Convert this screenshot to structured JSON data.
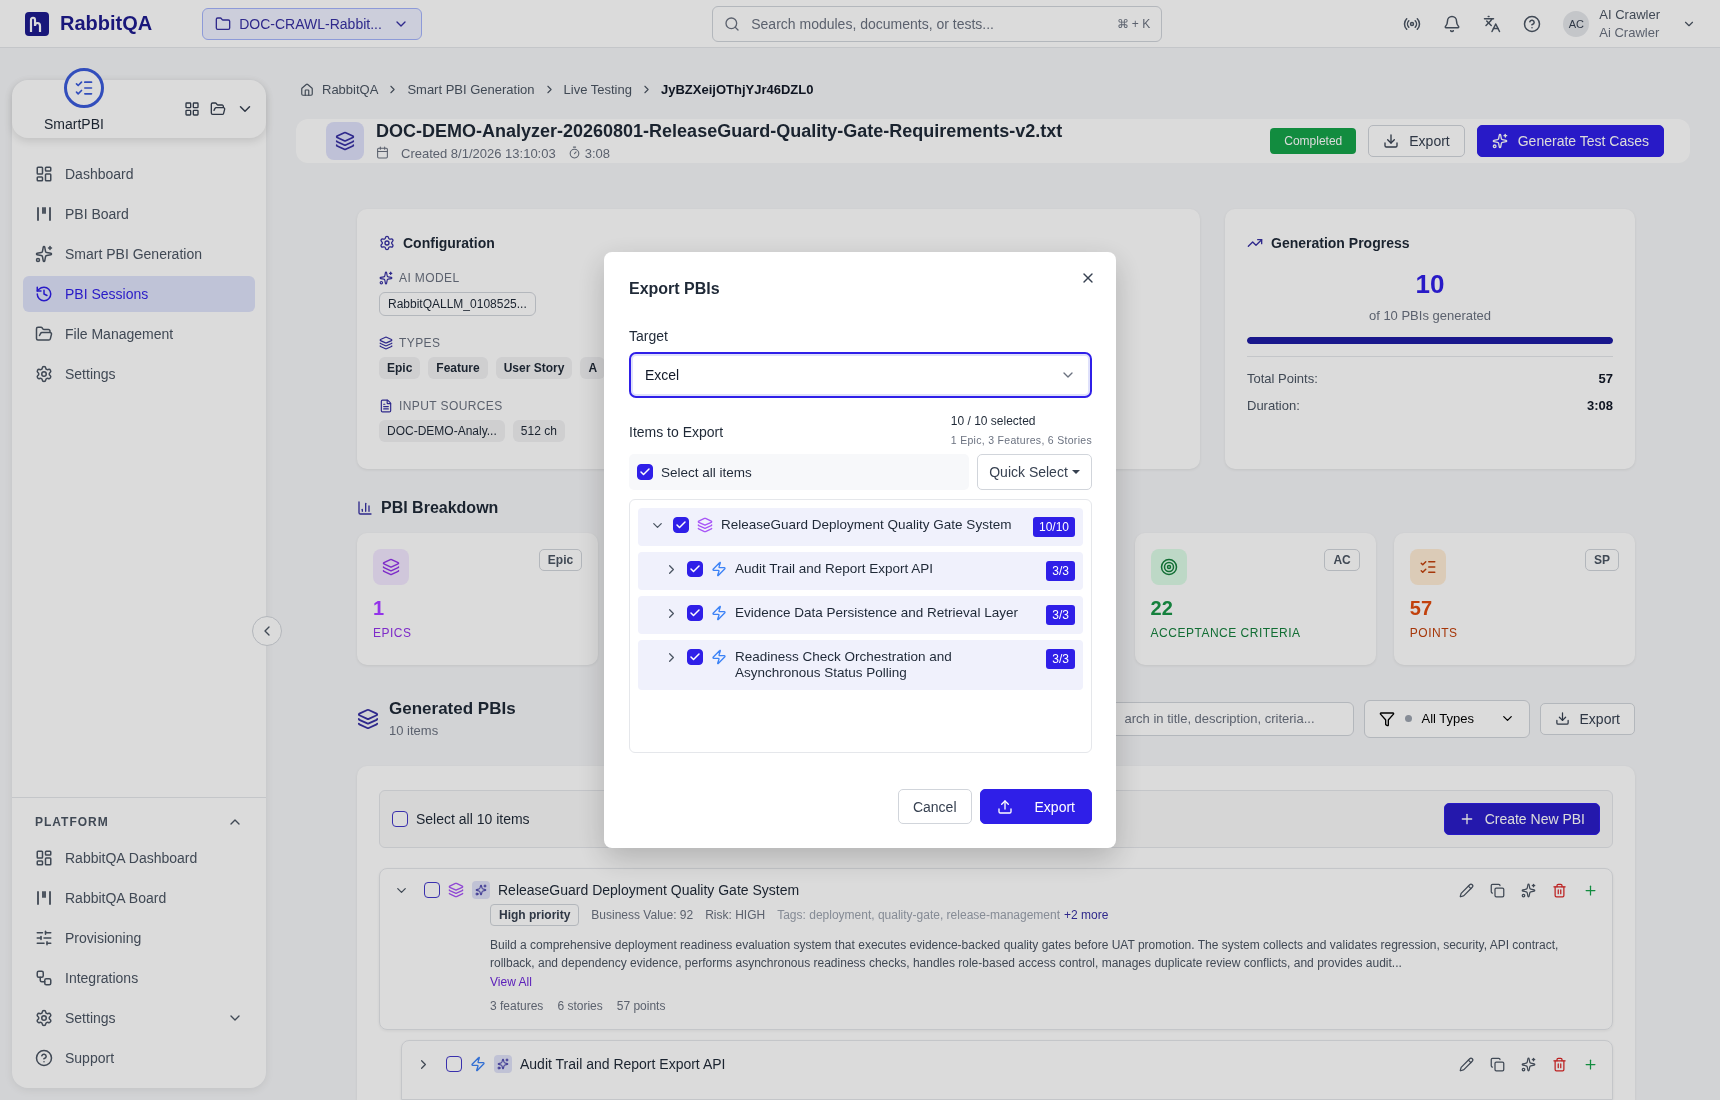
{
  "topbar": {
    "brand": "RabbitQA",
    "project": "DOC-CRAWL-Rabbit...",
    "search": {
      "placeholder": "Search modules, documents, or tests...",
      "shortcut": "⌘ + K"
    },
    "user": {
      "initials": "AC",
      "name": "AI Crawler",
      "subtitle": "Ai Crawler"
    }
  },
  "sidebar": {
    "app": "SmartPBI",
    "items": [
      {
        "label": "Dashboard",
        "selected": false
      },
      {
        "label": "PBI Board",
        "selected": false
      },
      {
        "label": "Smart PBI Generation",
        "selected": false
      },
      {
        "label": "PBI Sessions",
        "selected": true
      },
      {
        "label": "File Management",
        "selected": false
      },
      {
        "label": "Settings",
        "selected": false
      }
    ],
    "platform": {
      "title": "PLATFORM",
      "expanded": true,
      "items": [
        {
          "label": "RabbitQA Dashboard",
          "kind": "link"
        },
        {
          "label": "RabbitQA Board",
          "kind": "link"
        },
        {
          "label": "Provisioning",
          "kind": "link"
        },
        {
          "label": "Integrations",
          "kind": "link"
        },
        {
          "label": "Settings",
          "kind": "group"
        },
        {
          "label": "Support",
          "kind": "link"
        }
      ]
    }
  },
  "breadcrumb": [
    "RabbitQA",
    "Smart PBI Generation",
    "Live Testing",
    "JyBZXeijOThjYJr46DZL0"
  ],
  "header": {
    "title": "DOC-DEMO-Analyzer-20260801-ReleaseGuard-Quality-Gate-Requirements-v2.txt",
    "created": "Created 8/1/2026 13:10:03",
    "duration": "3:08",
    "status": "Completed",
    "buttons": [
      "Export",
      "Generate Test Cases"
    ]
  },
  "configuration": {
    "title": "Configuration",
    "ai_model": {
      "label": "AI MODEL",
      "value": "RabbitQALLM_0108525..."
    },
    "types": {
      "label": "TYPES",
      "values": [
        "Epic",
        "Feature",
        "User Story",
        "A"
      ]
    },
    "input_sources": {
      "label": "INPUT SOURCES",
      "values": [
        "DOC-DEMO-Analy...",
        "512 ch"
      ]
    }
  },
  "progress": {
    "title": "Generation Progress",
    "count": "10",
    "caption": "of 10 PBIs generated",
    "level": 1,
    "stats": [
      {
        "label": "Total Points:",
        "value": "57"
      },
      {
        "label": "Duration:",
        "value": "3:08"
      }
    ]
  },
  "breakdown": {
    "title": "PBI Breakdown",
    "cards": [
      {
        "value": "1",
        "label": "EPICS",
        "badge": "Epic",
        "color": "#9333ea"
      },
      {
        "value": "22",
        "label": "ACCEPTANCE CRITERIA",
        "badge": "AC",
        "color": "#15803d"
      },
      {
        "value": "57",
        "label": "POINTS",
        "badge": "SP",
        "color": "#c2410c"
      }
    ]
  },
  "generated": {
    "title": "Generated PBIs",
    "count": "10 items",
    "search": {
      "placeholder": "arch in title, description, criteria..."
    },
    "filter": "All Types",
    "export": "Export",
    "select_all": {
      "label": "Select all 10 items",
      "checked": false
    },
    "create": "Create New PBI",
    "items": [
      {
        "title": "ReleaseGuard Deployment Quality Gate System",
        "kind": "epic",
        "expanded": true,
        "checked": false,
        "priority": "High priority",
        "business_value": "Business Value: 92",
        "risk": "Risk: HIGH",
        "tags": "Tags: deployment, quality-gate, release-management",
        "more": "+2 more",
        "description": "Build a comprehensive deployment readiness evaluation system that executes evidence-backed quality gates before UAT promotion. The system collects and validates regression, security, API contract, rollback, and dependency evidence, performs asynchronous readiness checks, handles role-based access control, manages duplicate review conflicts, and provides audit...",
        "link": "View All",
        "stats": [
          "3 features",
          "6 stories",
          "57 points"
        ],
        "children": [
          {
            "title": "Audit Trail and Report Export API",
            "kind": "feature",
            "expanded": false,
            "checked": false
          }
        ]
      }
    ]
  },
  "dialog": {
    "title": "Export PBIs",
    "target": {
      "label": "Target",
      "value": "Excel"
    },
    "items_label": "Items to Export",
    "selected_count": "10 / 10 selected",
    "summary": "1 Epic, 3 Features, 6 Stories",
    "select_all": {
      "label": "Select all items",
      "checked": true
    },
    "quick_select": "Quick Select",
    "tree": [
      {
        "title": "ReleaseGuard Deployment Quality Gate System",
        "kind": "epic",
        "expanded": true,
        "checked": true,
        "count": "10/10",
        "children": [
          {
            "title": "Audit Trail and Report Export API",
            "kind": "feature",
            "expanded": false,
            "checked": true,
            "count": "3/3"
          },
          {
            "title": "Evidence Data Persistence and Retrieval Layer",
            "kind": "feature",
            "expanded": false,
            "checked": true,
            "count": "3/3"
          },
          {
            "title": "Readiness Check Orchestration and Asynchronous Status Polling",
            "kind": "feature",
            "expanded": false,
            "checked": true,
            "count": "3/3"
          }
        ]
      }
    ],
    "buttons": [
      "Cancel",
      "Export"
    ]
  }
}
